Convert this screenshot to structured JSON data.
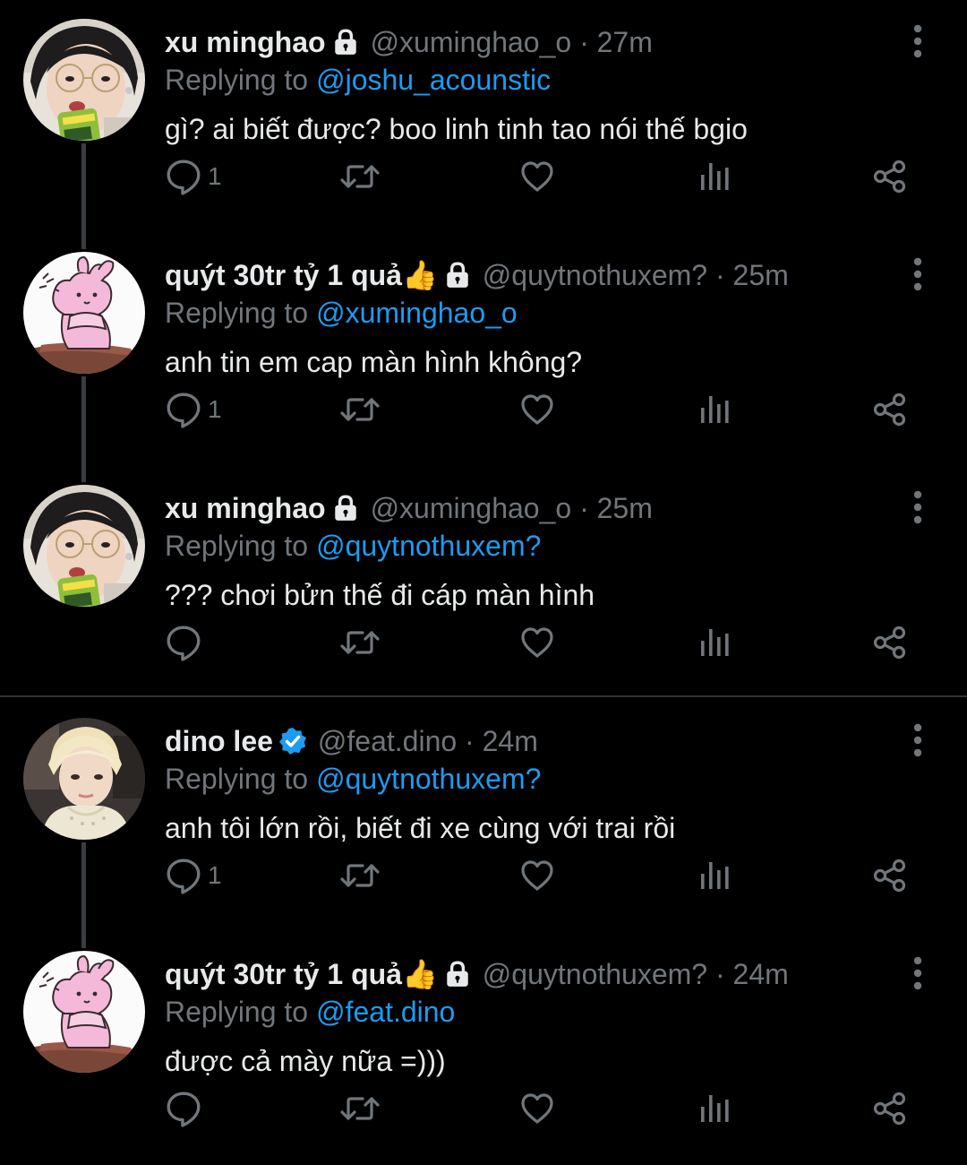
{
  "tweets": [
    {
      "name": "xu minghao",
      "handle": "@xuminghao_o",
      "time": "27m",
      "replying_label": "Replying to",
      "replying_to": "@joshu_acounstic",
      "text": "gì? ai biết được? boo linh tinh tao nói thế bgio",
      "reply_count": "1",
      "badge": "lock-icon",
      "avatar": "photo-boy-with-glasses"
    },
    {
      "name": "quýt 30tr tỷ 1 quả👍",
      "handle": "@quytnothuxem?",
      "time": "25m",
      "replying_label": "Replying to",
      "replying_to": "@xuminghao_o",
      "text": "anh tin em cap màn hình không?",
      "reply_count": "1",
      "badge": "lock-icon",
      "avatar": "pink-bunny-drawing"
    },
    {
      "name": "xu minghao",
      "handle": "@xuminghao_o",
      "time": "25m",
      "replying_label": "Replying to",
      "replying_to": "@quytnothuxem?",
      "text": "??? chơi bửn thế đi cáp màn hình",
      "reply_count": "",
      "badge": "lock-icon",
      "avatar": "photo-boy-with-glasses"
    },
    {
      "name": "dino lee",
      "handle": "@feat.dino",
      "time": "24m",
      "replying_label": "Replying to",
      "replying_to": "@quytnothuxem?",
      "text": "anh tôi lớn rồi, biết đi xe cùng với trai rồi",
      "reply_count": "1",
      "badge": "verified-icon",
      "avatar": "photo-blond-boy"
    },
    {
      "name": "quýt 30tr tỷ 1 quả👍",
      "handle": "@quytnothuxem?",
      "time": "24m",
      "replying_label": "Replying to",
      "replying_to": "@feat.dino",
      "text": "được cả mày nữa =)))",
      "reply_count": "",
      "badge": "lock-icon",
      "avatar": "pink-bunny-drawing"
    }
  ],
  "separator": "·",
  "colors": {
    "background": "#000000",
    "text": "#e7e9ea",
    "secondary": "#71767b",
    "accent": "#1d9bf0",
    "divider": "#2f3336",
    "thread_line": "#3a3d40"
  }
}
